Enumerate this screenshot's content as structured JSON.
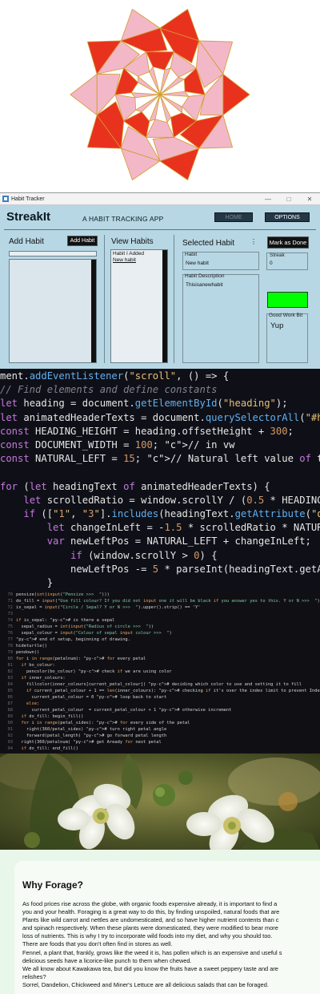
{
  "tracker": {
    "window_title": "Habit Tracker",
    "window_controls": [
      "—",
      "□",
      "✕"
    ],
    "brand": "StreakIt",
    "tagline": "A HABIT TRACKING APP",
    "nav": {
      "home": "HOME",
      "options": "OPTIONS"
    },
    "add_habit": {
      "title": "Add Habit",
      "button": "Add Habit",
      "input_value": ""
    },
    "view_habits": {
      "title": "View Habits",
      "items": [
        "Habit I Added",
        "New habit"
      ]
    },
    "selected_habit": {
      "title": "Selected Habit",
      "menu_glyph": "⋮",
      "mark_done_button": "Mark as Done",
      "habit_label": "Habit",
      "habit_value": "New habit",
      "description_label": "Habit Description",
      "description_value": "Thisisanewhabit",
      "streak_label": "Streak",
      "streak_value": "0",
      "good_work_label": "Good Work Bit",
      "good_work_value": "Yup",
      "status_color": "#00ff00"
    }
  },
  "js_code": {
    "lines": [
      "ment.addEventListener(\"scroll\", () => {",
      "// Find elements and define constants",
      "let heading = document.getElementById(\"heading\");",
      "let animatedHeaderTexts = document.querySelectorAll(\"#hea",
      "const HEADING_HEIGHT = heading.offsetHeight + 300;",
      "const DOCUMENT_WIDTH = 100; // in vw",
      "const NATURAL_LEFT = 15; // Natural left value of the hea",
      "",
      "for (let headingText of animatedHeaderTexts) {",
      "    let scrolledRatio = window.scrollY / (0.5 * HEADING_H",
      "    if ([\"1\", \"3\"].includes(headingText.getAttribute(\"da",
      "        let changeInLeft = -1.5 * scrolledRatio * NATURAL",
      "        var newLeftPos = NATURAL_LEFT + changeInLeft;",
      "            if (window.scrollY > 0) {",
      "            newLeftPos -= 5 * parseInt(headingText.getAtt",
      "        }"
    ]
  },
  "py_code": {
    "lines": [
      {
        "n": "70",
        "t": "pensize(int(input(\"Pensize >>>  \")))"
      },
      {
        "n": "71",
        "t": "do_fill = input(\"Use fill colour? If you did not input one it will be black if you answer yes to this. Y or N >>>  \")"
      },
      {
        "n": "72",
        "t": "is_sepal = input(\"Circle / Sepal? Y or N >>>  \").upper().strip() == 'Y'"
      },
      {
        "n": "73",
        "t": ""
      },
      {
        "n": "74",
        "t": "if is_sepal: # is there a sepal"
      },
      {
        "n": "75",
        "t": "  sepal_radius = int(input(\"Radius of circle >>>  \"))"
      },
      {
        "n": "76",
        "t": "  sepal_colour = input(\"Colour of sepal input colour >>>  \")"
      },
      {
        "n": "77",
        "t": "# end of setup, beginning of drawing."
      },
      {
        "n": "78",
        "t": "hideturtle()"
      },
      {
        "n": "79",
        "t": "pendown()"
      },
      {
        "n": "80",
        "t": "for i in range(petalnum): # for every petal"
      },
      {
        "n": "81",
        "t": "  if bo_colour:"
      },
      {
        "n": "82",
        "t": "    pencolor(bo_colour) # check if we are using color"
      },
      {
        "n": "83",
        "t": "  if inner_colours:"
      },
      {
        "n": "84",
        "t": "    fillcolor(inner_colours[current_petal_colour]) # deciding which color to use and setting it to fill"
      },
      {
        "n": "85",
        "t": "    if current_petal_colour + 1 == len(inner_colours): # checking if it's over the index limit to prevent IndexError"
      },
      {
        "n": "86",
        "t": "      current_petal_colour = 0 # loop back to start"
      },
      {
        "n": "87",
        "t": "    else:"
      },
      {
        "n": "88",
        "t": "      current_petal_colour  = current_petal_colour + 1 # otherwise increment"
      },
      {
        "n": "89",
        "t": "  if do_fill: begin_fill()"
      },
      {
        "n": "90",
        "t": "  for i in range(petal_sides): # for every side of the petal"
      },
      {
        "n": "91",
        "t": "    right(360/petal_sides) # turn right petal angle"
      },
      {
        "n": "92",
        "t": "    forward(petal_length) # go forward petal length"
      },
      {
        "n": "93",
        "t": "  right(360/petalnum) # get Aready for next petal"
      },
      {
        "n": "94",
        "t": "  if do_fill: end_fill()"
      }
    ]
  },
  "forage": {
    "title": "Why Forage?",
    "lines": [
      "As food prices rise across the globe, with organic foods expensive already, it is important to find a",
      "you and your health. Foraging is a great way to do this, by finding unspoiled, natural foods that are",
      "Plants like wild carrot and nettles are undomesticated, and so have higher nutrient contents than c",
      "and spinach respectively. When these plants were domesticated, they were modified to bear more",
      "loss of nutrients. This is why I try to incorporate wild foods into my diet, and why you should too.",
      "There are foods that you don't often find in stores as well.",
      "Fennel, a plant that, frankly, grows like the weed it is, has pollen which is an expensive and useful s",
      "delicious seeds have a licorice-like punch to them when chewed.",
      "We all know about Kawakawa tea, but did you know the fruits have a sweet peppery taste and are",
      "relishes?",
      "Sorrel, Dandelion, Chickweed and Miner's Lettuce are all delicious salads that can be foraged."
    ]
  },
  "colors": {
    "rosette_red": "#e8321e",
    "rosette_pink": "#f2b8c8",
    "rosette_stroke": "#d29a2a",
    "tracker_bg": "#b7d7e4",
    "forage_bg": "#e9f7ea"
  }
}
